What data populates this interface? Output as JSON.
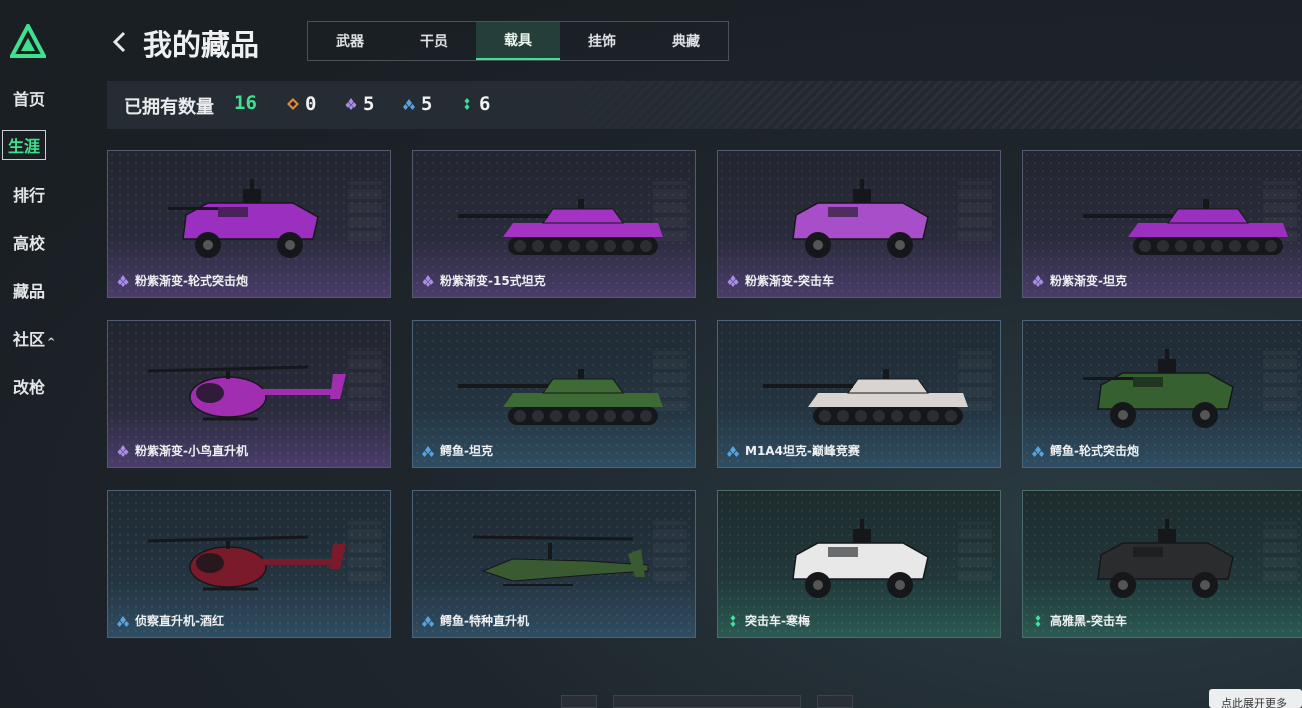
{
  "sidebar": {
    "logo": "triangle-logo",
    "items": [
      {
        "label": "首页",
        "active": false
      },
      {
        "label": "生涯",
        "active": true
      },
      {
        "label": "排行",
        "active": false
      },
      {
        "label": "高校",
        "active": false
      },
      {
        "label": "藏品",
        "active": false
      },
      {
        "label": "社区",
        "active": false,
        "caret": "^"
      },
      {
        "label": "改枪",
        "active": false
      }
    ]
  },
  "header": {
    "back_icon": "chevron-left-icon",
    "title": "我的藏品",
    "tabs": [
      {
        "label": "武器",
        "active": false
      },
      {
        "label": "干员",
        "active": false
      },
      {
        "label": "载具",
        "active": true
      },
      {
        "label": "挂饰",
        "active": false
      },
      {
        "label": "典藏",
        "active": false
      }
    ]
  },
  "stats": {
    "owned_label": "已拥有数量",
    "owned_count": "16",
    "rarities": [
      {
        "icon": "diamond-orange-icon",
        "color": "#e08a3a",
        "count": "0"
      },
      {
        "icon": "diamond-purple-icon",
        "color": "#a98ee8",
        "count": "5"
      },
      {
        "icon": "diamond-blue-icon",
        "color": "#5aa3e0",
        "count": "5"
      },
      {
        "icon": "diamond-green-icon",
        "color": "#3fe0a0",
        "count": "6"
      }
    ]
  },
  "colors": {
    "accent": "#3fe08e",
    "purple": "#a98ee8",
    "blue": "#5aa3e0",
    "green": "#3fe0a0"
  },
  "cards": [
    {
      "name": "粉紫渐变-轮式突击炮",
      "rarity": "purple",
      "vehicle": "wheeled-assault-gun",
      "body": "#9b2fbf"
    },
    {
      "name": "粉紫渐变-15式坦克",
      "rarity": "purple",
      "vehicle": "tank",
      "body": "#a433c4"
    },
    {
      "name": "粉紫渐变-突击车",
      "rarity": "purple",
      "vehicle": "assault-vehicle",
      "body": "#a84ec8"
    },
    {
      "name": "粉紫渐变-坦克",
      "rarity": "purple",
      "vehicle": "tank-small",
      "body": "#9a2fc0"
    },
    {
      "name": "粉紫渐变-小鸟直升机",
      "rarity": "purple",
      "vehicle": "little-bird",
      "body": "#a12eb0"
    },
    {
      "name": "鳄鱼-坦克",
      "rarity": "blue",
      "vehicle": "tank",
      "body": "#3e6a35"
    },
    {
      "name": "M1A4坦克-巅峰竞赛",
      "rarity": "blue",
      "vehicle": "tank",
      "body": "#d9d4d0"
    },
    {
      "name": "鳄鱼-轮式突击炮",
      "rarity": "blue",
      "vehicle": "wheeled-assault-gun",
      "body": "#36602f"
    },
    {
      "name": "侦察直升机-酒红",
      "rarity": "blue",
      "vehicle": "little-bird",
      "body": "#7a1a2a"
    },
    {
      "name": "鳄鱼-特种直升机",
      "rarity": "blue",
      "vehicle": "attack-helicopter",
      "body": "#3a5a32"
    },
    {
      "name": "突击车-寒梅",
      "rarity": "green",
      "vehicle": "assault-vehicle",
      "body": "#e8e8e8"
    },
    {
      "name": "高雅黑-突击车",
      "rarity": "green",
      "vehicle": "assault-vehicle",
      "body": "#2a2c2e"
    }
  ],
  "toast": {
    "text": "点此展开更多"
  }
}
